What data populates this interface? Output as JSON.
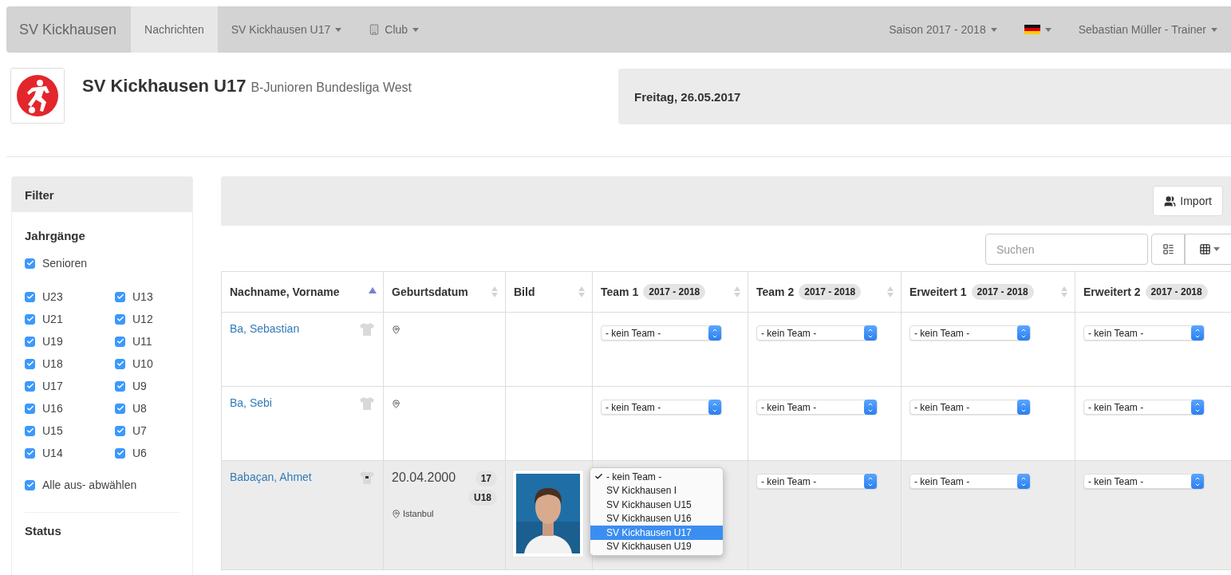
{
  "navbar": {
    "brand": "SV Kickhausen",
    "left_items": [
      {
        "kind": "plain",
        "label": "Nachrichten",
        "selected": true
      },
      {
        "kind": "dropdown",
        "label": "SV Kickhausen U17",
        "selected": false
      },
      {
        "kind": "icon-dropdown",
        "label": "Club",
        "selected": false
      }
    ],
    "right_items": [
      {
        "kind": "dropdown",
        "label": "Saison 2017 - 2018"
      },
      {
        "kind": "flag-dropdown"
      },
      {
        "kind": "dropdown",
        "label": "Sebastian Müller - Trainer"
      }
    ]
  },
  "team": {
    "name": "SV Kickhausen U17",
    "league": "B-Junioren Bundesliga West"
  },
  "date_panel": {
    "date": "Freitag, 26.05.2017"
  },
  "filter": {
    "title": "Filter",
    "section": "Jahrgänge",
    "seniors": {
      "label": "Senioren",
      "checked": true
    },
    "age_columns": [
      [
        {
          "label": "U23",
          "checked": true
        },
        {
          "label": "U21",
          "checked": true
        },
        {
          "label": "U19",
          "checked": true
        },
        {
          "label": "U18",
          "checked": true
        },
        {
          "label": "U17",
          "checked": true
        },
        {
          "label": "U16",
          "checked": true
        },
        {
          "label": "U15",
          "checked": true
        },
        {
          "label": "U14",
          "checked": true
        }
      ],
      [
        {
          "label": "U13",
          "checked": true
        },
        {
          "label": "U12",
          "checked": true
        },
        {
          "label": "U11",
          "checked": true
        },
        {
          "label": "U10",
          "checked": true
        },
        {
          "label": "U9",
          "checked": true
        },
        {
          "label": "U8",
          "checked": true
        },
        {
          "label": "U7",
          "checked": true
        },
        {
          "label": "U6",
          "checked": true
        }
      ]
    ],
    "toggle_all": {
      "label": "Alle aus- abwählen",
      "checked": true
    },
    "status_title": "Status"
  },
  "toolbar": {
    "import_label": "Import",
    "search_placeholder": "Suchen"
  },
  "table": {
    "columns": [
      {
        "label": "Nachname, Vorname",
        "sortable": true,
        "sorted": true
      },
      {
        "label": "Geburtsdatum",
        "sortable": true,
        "sorted": false
      },
      {
        "label": "Bild",
        "sortable": true,
        "sorted": false
      },
      {
        "label": "Team 1",
        "badge": "2017 - 2018",
        "sortable": true,
        "sorted": false
      },
      {
        "label": "Team 2",
        "badge": "2017 - 2018",
        "sortable": true,
        "sorted": false
      },
      {
        "label": "Erweitert 1",
        "badge": "2017 - 2018",
        "sortable": true,
        "sorted": false
      },
      {
        "label": "Erweitert 2",
        "badge": "2017 - 2018",
        "sortable": false,
        "sorted": false
      }
    ],
    "rows": [
      {
        "name": "Ba, Sebastian",
        "jersey_numbered": false,
        "highlighted": false,
        "teams": [
          {
            "value": "- kein Team -"
          },
          {
            "value": "- kein Team -"
          },
          {
            "value": "- kein Team -"
          },
          {
            "value": "- kein Team -"
          }
        ]
      },
      {
        "name": "Ba, Sebi",
        "jersey_numbered": false,
        "highlighted": false,
        "teams": [
          {
            "value": "- kein Team -"
          },
          {
            "value": "- kein Team -"
          },
          {
            "value": "- kein Team -"
          },
          {
            "value": "- kein Team -"
          }
        ]
      },
      {
        "name": "Babaçan, Ahmet",
        "jersey_numbered": true,
        "highlighted": true,
        "birth_date": "20.04.2000",
        "age": "17",
        "age_group": "U18",
        "place": "Istanbul",
        "teams": [
          {
            "open": true,
            "options": [
              {
                "label": "- kein Team -",
                "checked": true,
                "highlighted": false
              },
              {
                "label": "SV Kickhausen I",
                "checked": false,
                "highlighted": false
              },
              {
                "label": "SV Kickhausen U15",
                "checked": false,
                "highlighted": false
              },
              {
                "label": "SV Kickhausen U16",
                "checked": false,
                "highlighted": false
              },
              {
                "label": "SV Kickhausen U17",
                "checked": false,
                "highlighted": true
              },
              {
                "label": "SV Kickhausen U19",
                "checked": false,
                "highlighted": false
              }
            ]
          },
          {
            "value": "- kein Team -"
          },
          {
            "value": "- kein Team -"
          },
          {
            "value": "- kein Team -"
          }
        ]
      }
    ]
  }
}
